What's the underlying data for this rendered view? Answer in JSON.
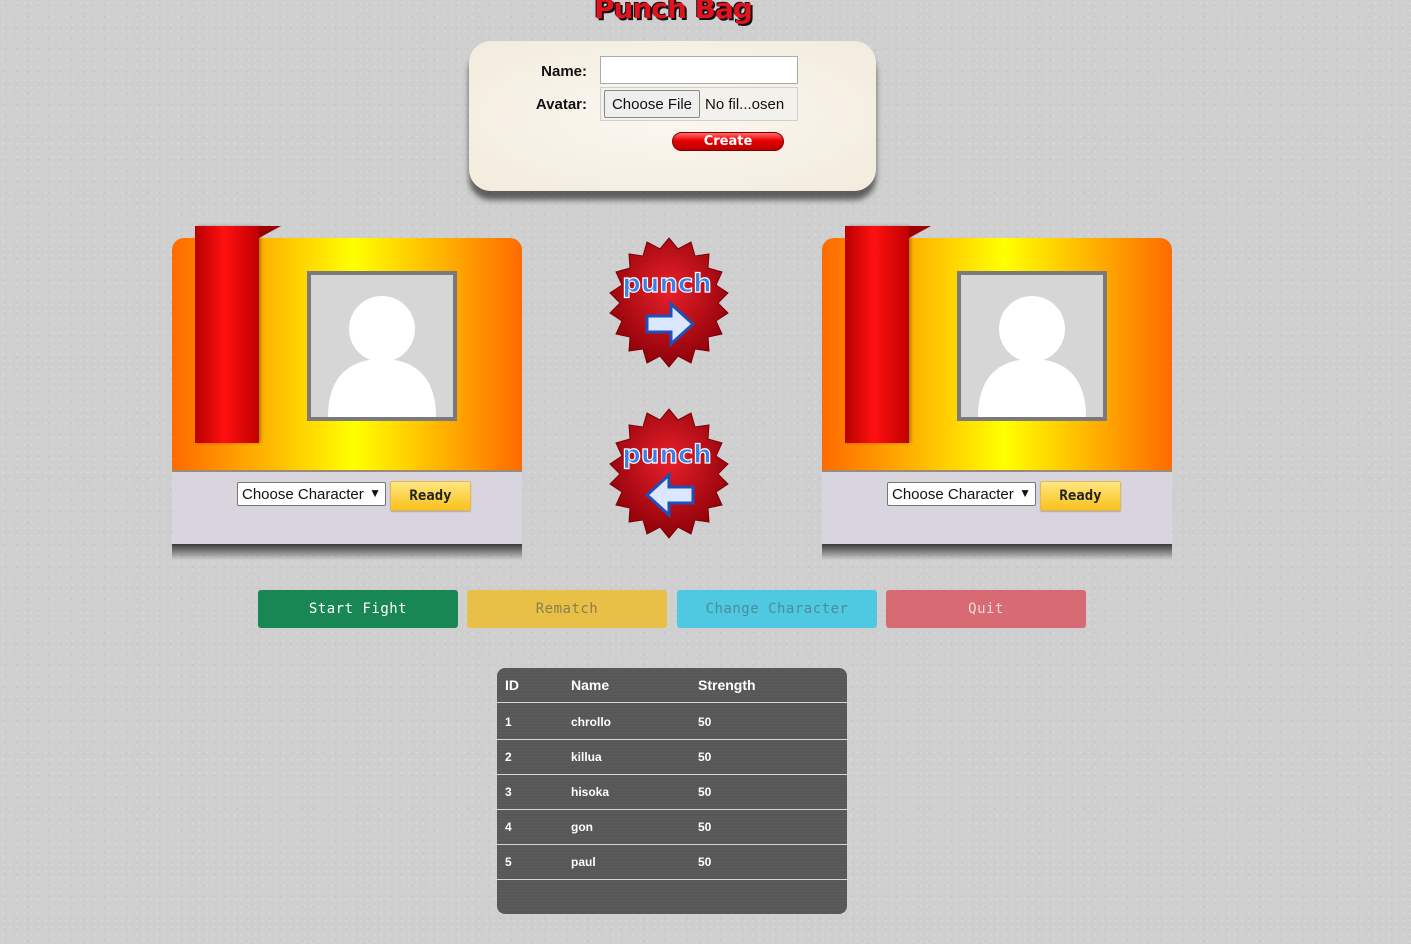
{
  "app": {
    "title": "Punch Bag"
  },
  "create_form": {
    "name_label": "Name:",
    "name_value": "",
    "avatar_label": "Avatar:",
    "file_button": "Choose File",
    "file_status": "No fil...osen",
    "create_button": "Create"
  },
  "players": [
    {
      "select_value": "Choose Character",
      "ready_label": "Ready"
    },
    {
      "select_value": "Choose Character",
      "ready_label": "Ready"
    }
  ],
  "punch": {
    "right_label": "punch",
    "left_label": "punch"
  },
  "actions": {
    "start": "Start Fight",
    "rematch": "Rematch",
    "change": "Change Character",
    "quit": "Quit"
  },
  "table": {
    "headers": [
      "ID",
      "Name",
      "Strength"
    ],
    "rows": [
      {
        "id": "1",
        "name": "chrollo",
        "strength": "50"
      },
      {
        "id": "2",
        "name": "killua",
        "strength": "50"
      },
      {
        "id": "3",
        "name": "hisoka",
        "strength": "50"
      },
      {
        "id": "4",
        "name": "gon",
        "strength": "50"
      },
      {
        "id": "5",
        "name": "paul",
        "strength": "50"
      }
    ]
  },
  "colors": {
    "start": "#198754",
    "rematch": "#e8c048",
    "change": "#4fc8e2",
    "quit": "#d86a73",
    "title": "#e3121f"
  }
}
